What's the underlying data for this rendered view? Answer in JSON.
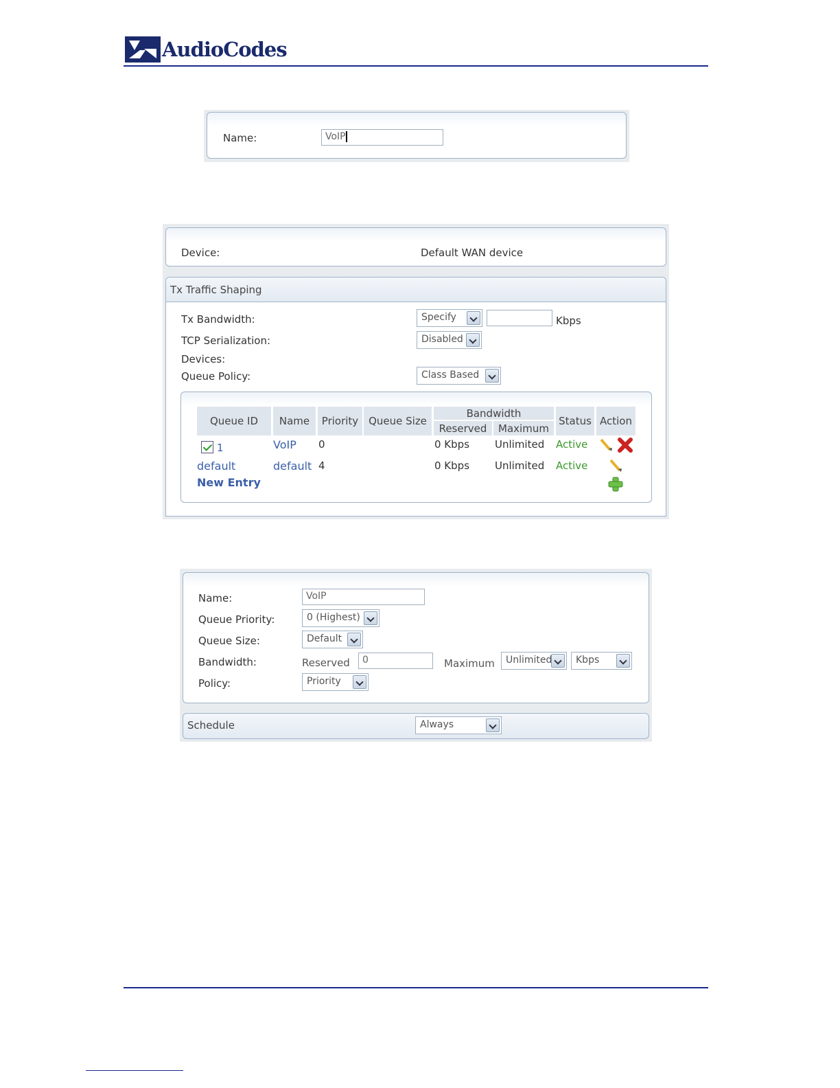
{
  "header": {
    "company": "AudioCodes"
  },
  "name_screen": {
    "label": "Name:",
    "value": "VoIP"
  },
  "traffic_screen": {
    "device_label": "Device:",
    "device_value": "Default WAN device",
    "section_title": "Tx Traffic Shaping",
    "tx_bandwidth_label": "Tx Bandwidth:",
    "tx_bandwidth_select": "Specify",
    "tx_bandwidth_value": "",
    "tx_bandwidth_unit": "Kbps",
    "tcp_label": "TCP Serialization:",
    "tcp_select": "Disabled",
    "devices_label": "Devices:",
    "queue_policy_label": "Queue Policy:",
    "queue_policy_select": "Class Based",
    "table": {
      "headers": {
        "queue_id": "Queue ID",
        "name": "Name",
        "priority": "Priority",
        "queue_size": "Queue Size",
        "bandwidth": "Bandwidth",
        "reserved": "Reserved",
        "maximum": "Maximum",
        "status": "Status",
        "action": "Action"
      },
      "rows": [
        {
          "id": "1",
          "name": "VoIP",
          "priority": "0",
          "queue_size": "",
          "reserved": "0 Kbps",
          "maximum": "Unlimited",
          "status": "Active"
        },
        {
          "id": "default",
          "name": "default",
          "priority": "4",
          "queue_size": "",
          "reserved": "0 Kbps",
          "maximum": "Unlimited",
          "status": "Active"
        }
      ],
      "new_entry": "New Entry"
    }
  },
  "queue_screen": {
    "name_label": "Name:",
    "name_value": "VoIP",
    "priority_label": "Queue Priority:",
    "priority_select": "0 (Highest)",
    "size_label": "Queue Size:",
    "size_select": "Default",
    "bandwidth_label": "Bandwidth:",
    "reserved_label": "Reserved",
    "reserved_value": "0",
    "maximum_label": "Maximum",
    "maximum_select": "Unlimited",
    "unit_select": "Kbps",
    "policy_label": "Policy:",
    "policy_select": "Priority",
    "schedule_label": "Schedule",
    "schedule_select": "Always"
  }
}
